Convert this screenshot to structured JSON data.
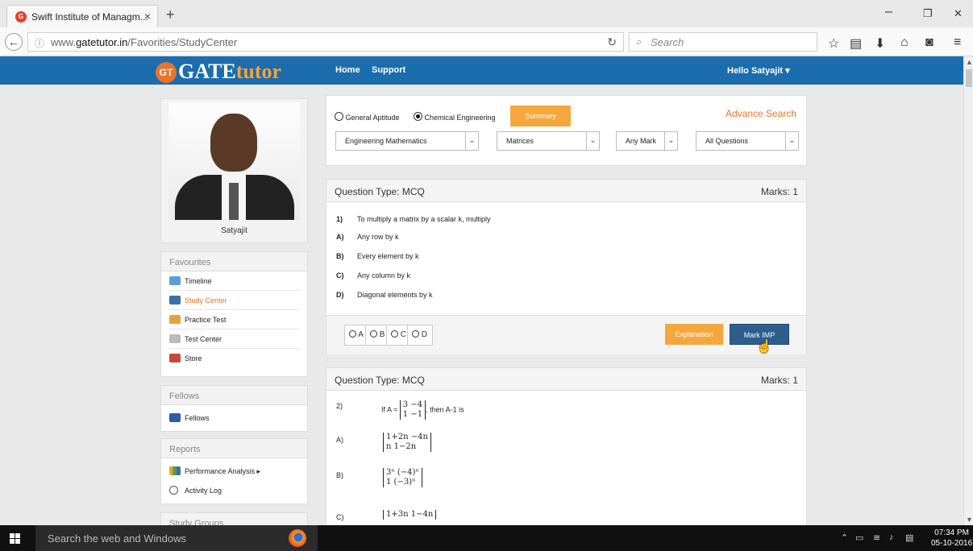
{
  "browser": {
    "tab_title": "Swift Institute of Managm...",
    "tab_close": "×",
    "new_tab": "+",
    "url_prefix": "www.",
    "url_domain": "gatetutor.in",
    "url_path": "/Favorities/StudyCenter",
    "search_placeholder": "Search",
    "win_minimize": "–",
    "win_restore": "❐",
    "win_close": "✕"
  },
  "site": {
    "logo_badge": "GT",
    "logo_main": "GATE",
    "logo_sub": "tutor",
    "nav": [
      "Home",
      "Support"
    ],
    "greeting": "Hello Satyajit ▾"
  },
  "profile": {
    "name": "Satyajit"
  },
  "sidebar": {
    "favourites": {
      "title": "Favourites",
      "items": [
        "Timeline",
        "Study Center",
        "Practice Test",
        "Test Center",
        "Store"
      ],
      "active": "Study Center"
    },
    "fellows": {
      "title": "Fellows",
      "items": [
        "Fellows"
      ]
    },
    "reports": {
      "title": "Reports",
      "items": [
        "Performance Analysis ▸",
        "Activity Log"
      ]
    },
    "study_groups": {
      "title": "Study Groups"
    }
  },
  "filters": {
    "subject_options": [
      "General Aptitude",
      "Chemical Engineering"
    ],
    "selected_subject": "Chemical Engineering",
    "summary_button": "Summary",
    "advance_search": "Advance Search",
    "topic": "Engineering Mathematics",
    "subtopic": "Matrices",
    "marks": "Any Mark",
    "question_filter": "All Questions"
  },
  "questions": [
    {
      "type_label": "Question Type: MCQ",
      "marks_label": "Marks: 1",
      "number": "1)",
      "text": "To multiply a matrix by a scalar k, multiply",
      "options": [
        {
          "key": "A)",
          "text": "Any row by k"
        },
        {
          "key": "B)",
          "text": "Every element by k"
        },
        {
          "key": "C)",
          "text": "Any column by k"
        },
        {
          "key": "D)",
          "text": "Diagonal elements by k"
        }
      ],
      "answer_choices": [
        "A",
        "B",
        "C",
        "D"
      ],
      "explanation_button": "Explanation",
      "mark_imp_button": "Mark IMP"
    },
    {
      "type_label": "Question Type: MCQ",
      "marks_label": "Marks: 1",
      "number": "2)",
      "text_prefix": "If A =",
      "matrix": [
        "3   −4",
        "1   −1"
      ],
      "text_suffix": ", then A-1  is",
      "options": [
        {
          "key": "A)",
          "rows": [
            "1+2n   −4n",
            "n     1−2n"
          ]
        },
        {
          "key": "B)",
          "rows": [
            "3ⁿ   (−4)ⁿ",
            "1   (−3)ⁿ"
          ]
        },
        {
          "key": "C)",
          "rows": [
            "1+3n   1−4n"
          ]
        }
      ]
    }
  ],
  "taskbar": {
    "search": "Search the web and Windows",
    "time": "07:34 PM",
    "date": "05-10-2016"
  },
  "colors": {
    "brand_blue": "#1b6dad",
    "accent_orange": "#f4a73c",
    "mark_imp_blue": "#2d5e8e"
  }
}
